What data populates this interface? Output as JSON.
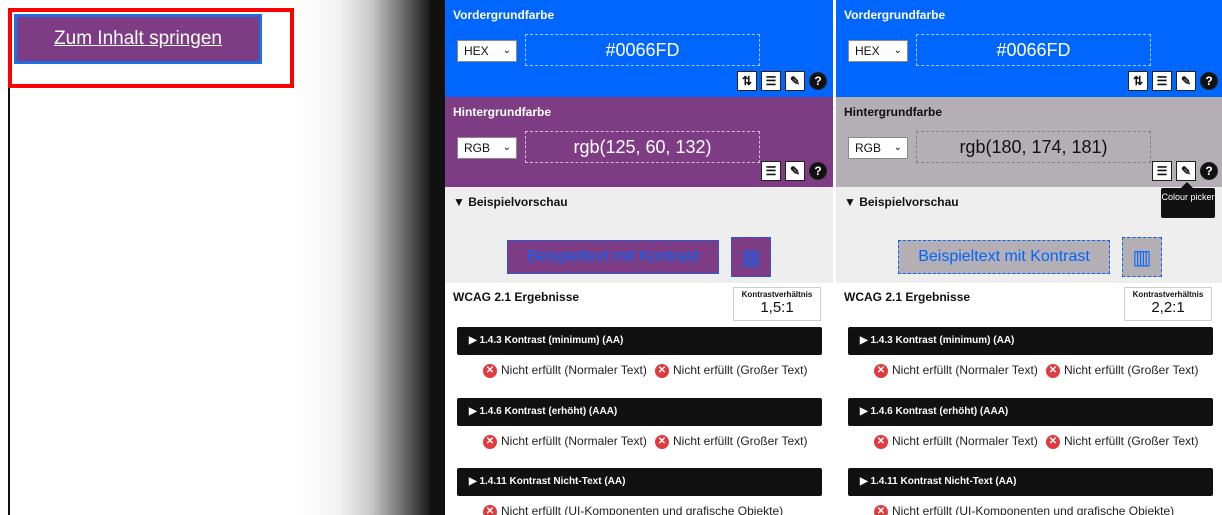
{
  "skip_link": {
    "label": "Zum Inhalt springen"
  },
  "panels": [
    {
      "foreground": {
        "title": "Vordergrundfarbe",
        "format": "HEX",
        "value": "#0066FD",
        "color": "#0066FD"
      },
      "background": {
        "title": "Hintergrundfarbe",
        "format": "RGB",
        "value": "rgb(125, 60, 132)",
        "color": "#7D3C84"
      },
      "preview": {
        "heading": "▼ Beispielvorschau",
        "sample_text": "Beispieltext mit Kontrast"
      },
      "wcag": {
        "title": "WCAG 2.1 Ergebnisse",
        "ratio_label": "Kontrastverhältnis",
        "ratio_value": "1,5:1",
        "criteria": [
          {
            "label": "▶ 1.4.3 Kontrast (minimum) (AA)",
            "normal": "Nicht erfüllt (Normaler Text)",
            "large": "Nicht erfüllt (Großer Text)"
          },
          {
            "label": "▶ 1.4.6 Kontrast (erhöht) (AAA)",
            "normal": "Nicht erfüllt (Normaler Text)",
            "large": "Nicht erfüllt (Großer Text)"
          },
          {
            "label": "▶ 1.4.11 Kontrast Nicht-Text (AA)",
            "ui": "Nicht erfüllt (UI-Komponenten und grafische Objekte)"
          }
        ]
      }
    },
    {
      "foreground": {
        "title": "Vordergrundfarbe",
        "format": "HEX",
        "value": "#0066FD",
        "color": "#0066FD"
      },
      "background": {
        "title": "Hintergrundfarbe",
        "format": "RGB",
        "value": "rgb(180, 174, 181)",
        "color": "#B4AEB5"
      },
      "tooltip": "Colour picker",
      "preview": {
        "heading": "▼ Beispielvorschau",
        "sample_text": "Beispieltext mit Kontrast"
      },
      "wcag": {
        "title": "WCAG 2.1 Ergebnisse",
        "ratio_label": "Kontrastverhältnis",
        "ratio_value": "2,2:1",
        "criteria": [
          {
            "label": "▶ 1.4.3 Kontrast (minimum) (AA)",
            "normal": "Nicht erfüllt (Normaler Text)",
            "large": "Nicht erfüllt (Großer Text)"
          },
          {
            "label": "▶ 1.4.6 Kontrast (erhöht) (AAA)",
            "normal": "Nicht erfüllt (Normaler Text)",
            "large": "Nicht erfüllt (Großer Text)"
          },
          {
            "label": "▶ 1.4.11 Kontrast Nicht-Text (AA)",
            "ui": "Nicht erfüllt (UI-Komponenten und grafische Objekte)"
          }
        ]
      }
    }
  ],
  "icons": {
    "swap": "swap-icon",
    "adjust": "sliders-icon",
    "picker": "eyedropper-icon",
    "help": "help-icon",
    "fail": "x-circle-icon",
    "chart": "chart-icon"
  }
}
